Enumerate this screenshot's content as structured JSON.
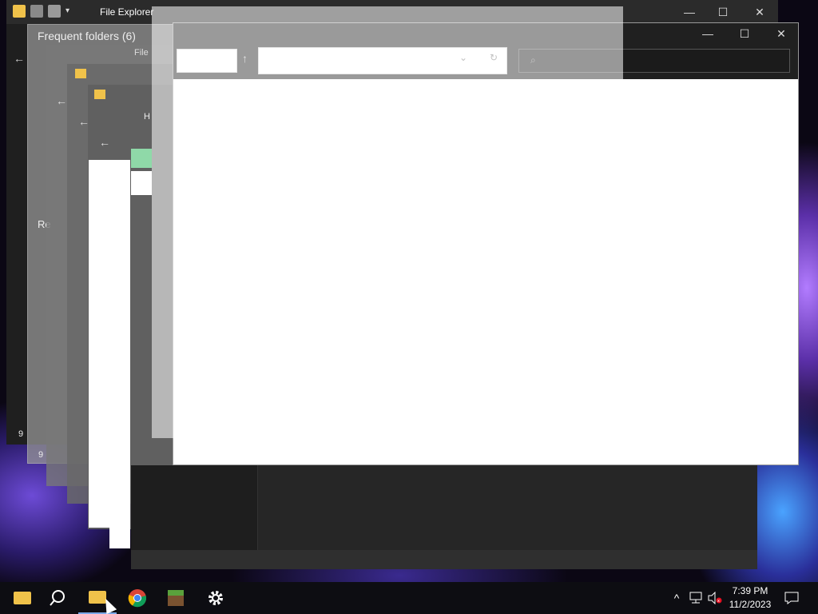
{
  "back_window": {
    "title": "File Explorer",
    "minimize": "—",
    "maximize": "☐",
    "close": "✕"
  },
  "ghost_window": {
    "heading": "Frequent folders (6)",
    "side_label": "Re",
    "status_a": "9",
    "status_b": "9",
    "address_snippet": "File",
    "header_snippet": "H"
  },
  "main_window": {
    "minimize": "—",
    "maximize": "☐",
    "close": "✕",
    "address_value": "",
    "search_placeholder": ""
  },
  "taskbar": {
    "apps": [
      {
        "name": "file-explorer-pinned"
      },
      {
        "name": "search"
      },
      {
        "name": "file-explorer-active"
      },
      {
        "name": "chrome"
      },
      {
        "name": "minecraft"
      },
      {
        "name": "settings"
      }
    ],
    "clock_time": "7:39 PM",
    "clock_date": "11/2/2023"
  },
  "colors": {
    "taskbar_bg": "#0d0d12",
    "titlebar_dark": "#202020",
    "folder_yellow": "#f0c24a",
    "settings_white": "#ffffff"
  }
}
